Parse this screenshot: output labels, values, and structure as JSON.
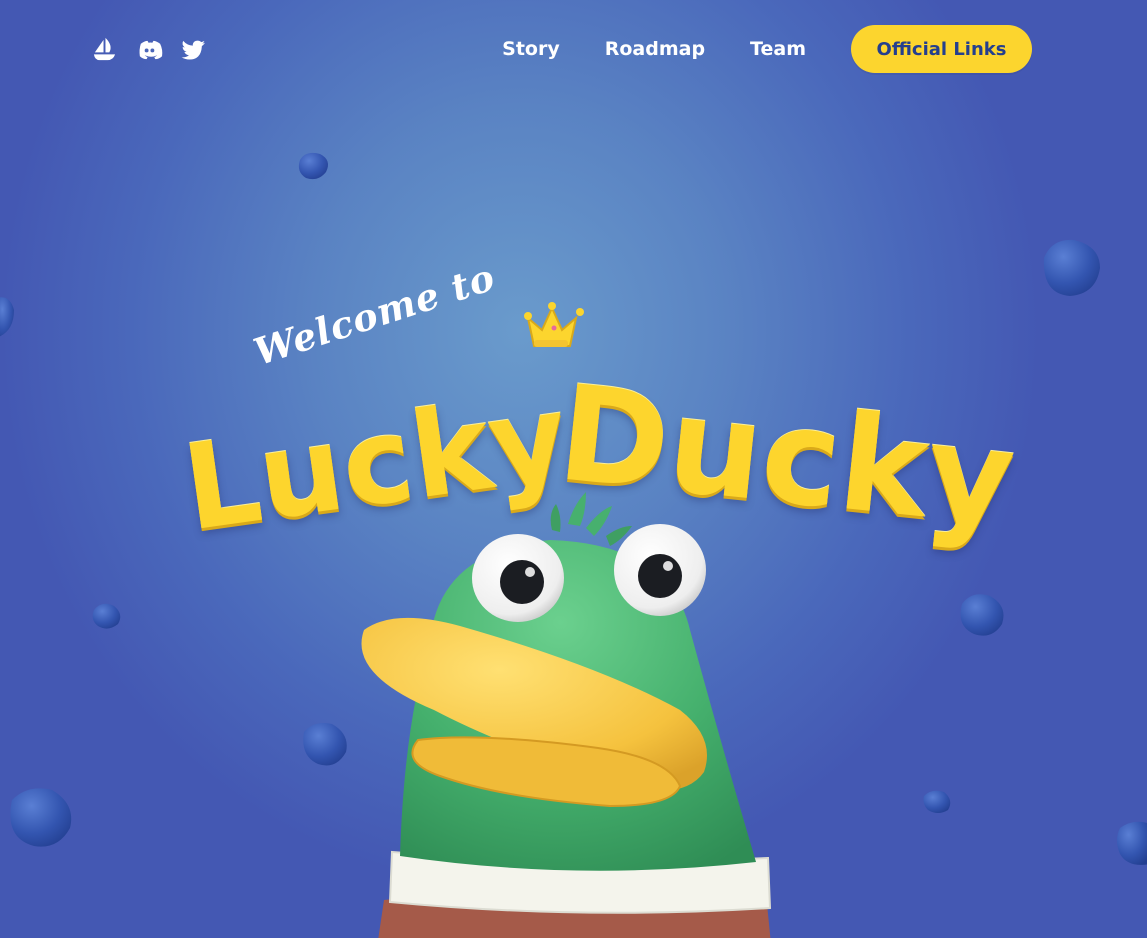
{
  "header": {
    "social": [
      {
        "icon": "opensea-icon",
        "label": "OpenSea"
      },
      {
        "icon": "discord-icon",
        "label": "Discord"
      },
      {
        "icon": "twitter-icon",
        "label": "Twitter"
      }
    ],
    "nav": {
      "story": "Story",
      "roadmap": "Roadmap",
      "team": "Team"
    },
    "cta_label": "Official Links"
  },
  "hero": {
    "welcome_text": "Welcome to",
    "title_word_1": "Lucky",
    "title_word_2": "Ducky"
  },
  "colors": {
    "background": "#4f6fbd",
    "background_center": "#6a9bcc",
    "accent_yellow": "#fcd52e",
    "cta_text": "#243f8e",
    "duck_green": "#3fae6a",
    "duck_beak": "#f7c84a",
    "collar_white": "#f4f4ec",
    "body_brown": "#a55a49"
  }
}
